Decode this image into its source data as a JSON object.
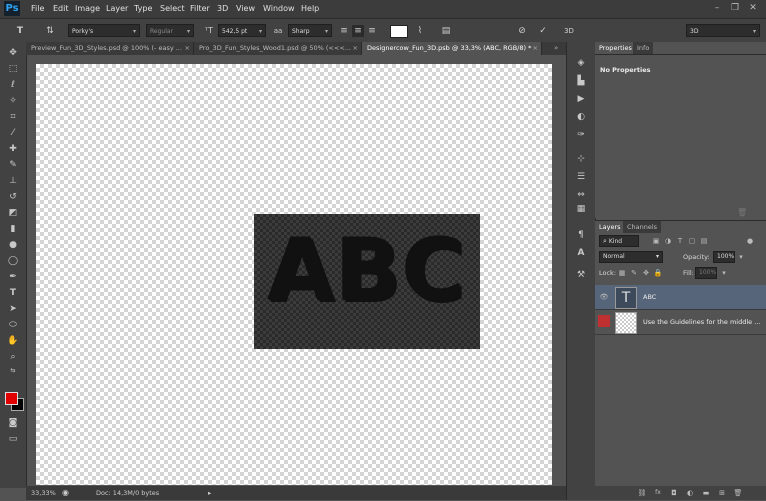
{
  "app": {
    "logo": "Ps"
  },
  "menu": [
    "File",
    "Edit",
    "Image",
    "Layer",
    "Type",
    "Select",
    "Filter",
    "3D",
    "View",
    "Window",
    "Help"
  ],
  "window_controls": {
    "minimize": "–",
    "restore": "❐",
    "close": "✕"
  },
  "options_bar": {
    "font_family": "Porky's",
    "font_style": "Regular",
    "font_size": "542,5 pt",
    "antialias": "Sharp",
    "workspace": "3D",
    "mode_3d_label": "3D"
  },
  "tabs": [
    {
      "label": "Preview_Fun_3D_Styles.psd @ 100% (- easy ...",
      "active": false
    },
    {
      "label": "Pro_3D_Fun_Styles_Wood1.psd @ 50% (<<<...",
      "active": false
    },
    {
      "label": "Designercow_Fun_3D.psb @ 33,3% (ABC, RGB/8) *",
      "active": true
    }
  ],
  "canvas": {
    "text": "ABC"
  },
  "status": {
    "zoom": "33,33%",
    "doc": "Doc: 14,3M/0 bytes"
  },
  "properties": {
    "tabs": [
      "Properties",
      "Info"
    ],
    "content": "No Properties"
  },
  "layers_panel": {
    "tabs": [
      "Layers",
      "Channels"
    ],
    "filter_kind": "Kind",
    "blend_mode": "Normal",
    "opacity_label": "Opacity:",
    "opacity_value": "100%",
    "lock_label": "Lock:",
    "fill_label": "Fill:",
    "fill_value": "100%",
    "layers": [
      {
        "name": "ABC",
        "type": "text",
        "selected": true
      },
      {
        "name": "Use the Guidelines for the middle ...",
        "type": "image",
        "selected": false
      }
    ]
  },
  "colors": {
    "foreground": "#e00000",
    "background": "#000000",
    "selection": "#56657a"
  }
}
